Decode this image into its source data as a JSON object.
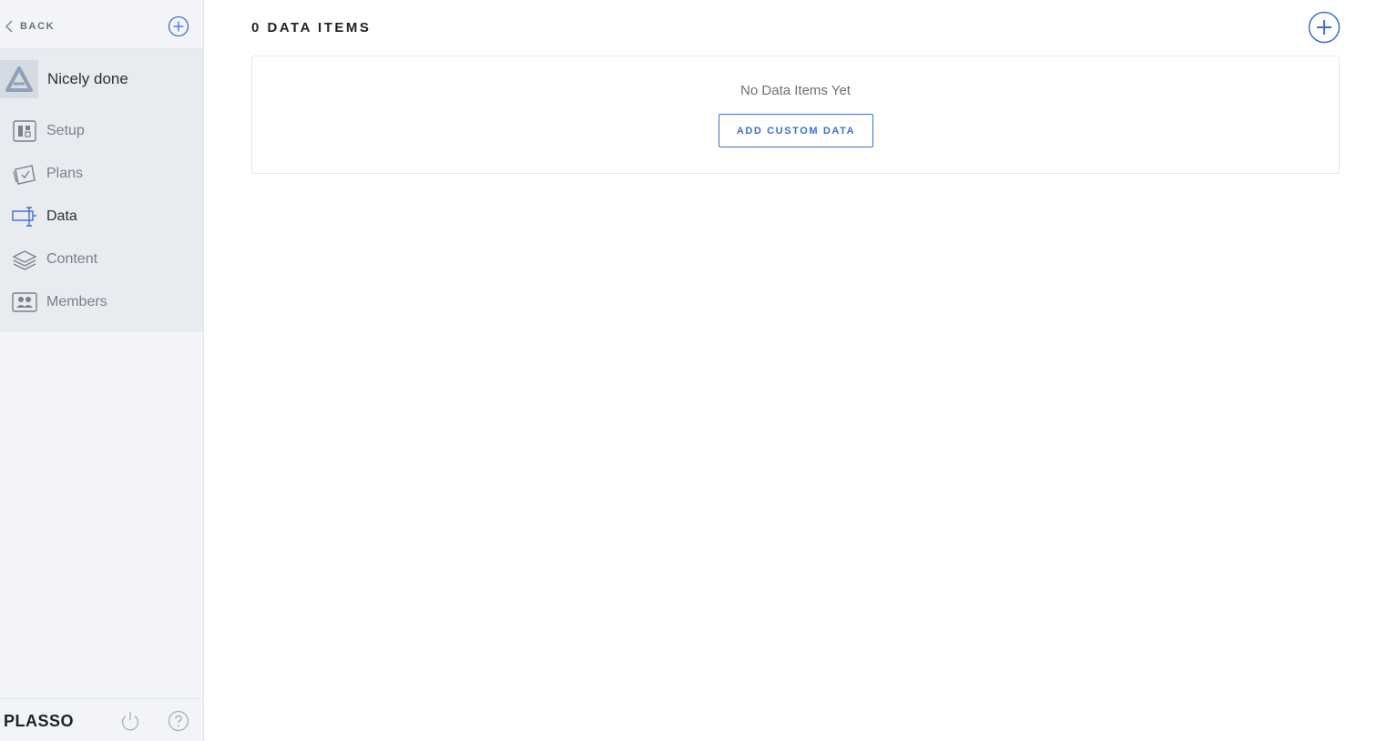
{
  "sidebar": {
    "back_label": "BACK",
    "site_name": "Nicely done",
    "nav": [
      {
        "label": "Setup",
        "icon": "setup-icon",
        "active": false
      },
      {
        "label": "Plans",
        "icon": "plans-icon",
        "active": false
      },
      {
        "label": "Data",
        "icon": "data-icon",
        "active": true
      },
      {
        "label": "Content",
        "icon": "content-icon",
        "active": false
      },
      {
        "label": "Members",
        "icon": "members-icon",
        "active": false
      }
    ],
    "brand": "PLASSO"
  },
  "main": {
    "title": "0 DATA ITEMS",
    "empty_message": "No Data Items Yet",
    "add_custom_label": "ADD CUSTOM DATA"
  },
  "colors": {
    "accent": "#3d6fd0",
    "sidebar_bg": "#f2f4f7",
    "site_block_bg": "#e8ecf1",
    "text_dark": "#2d3136",
    "text_muted": "#7a8088"
  }
}
